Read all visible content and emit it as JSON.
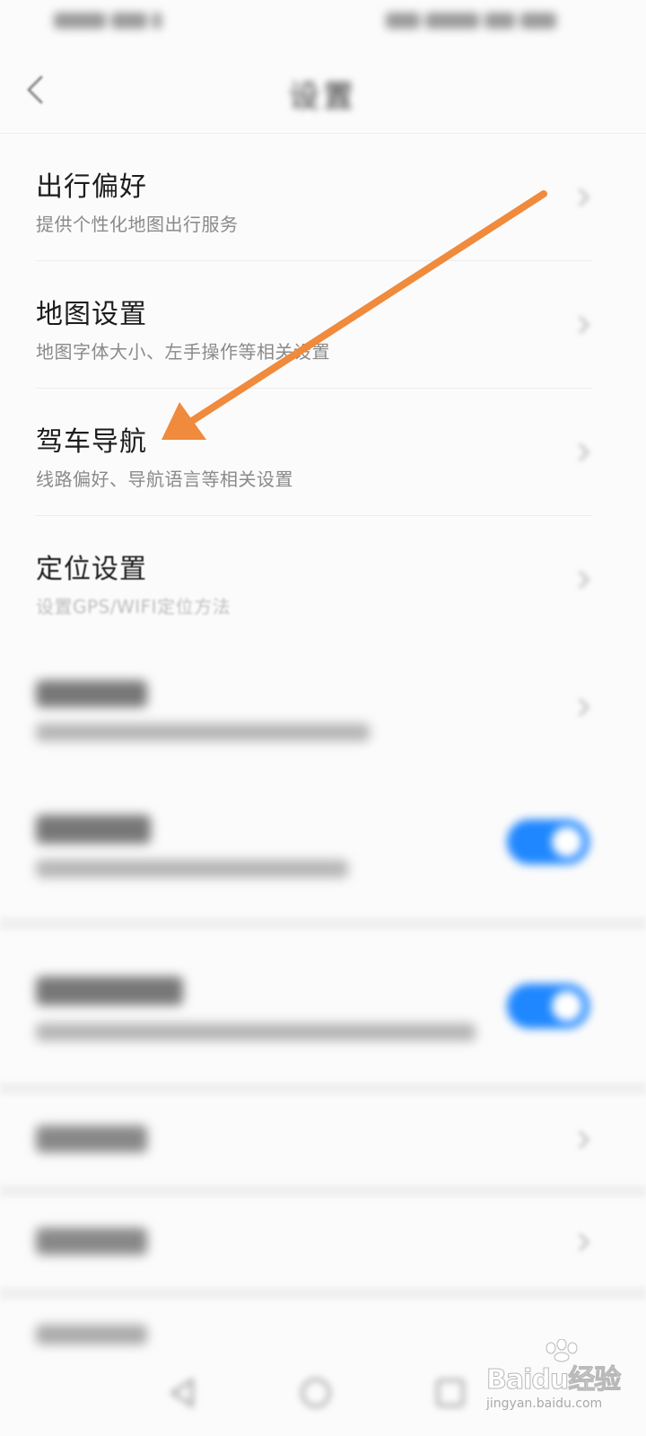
{
  "status_bar": {},
  "header": {
    "title": "设置"
  },
  "settings": [
    {
      "title": "出行偏好",
      "subtitle": "提供个性化地图出行服务"
    },
    {
      "title": "地图设置",
      "subtitle": "地图字体大小、左手操作等相关设置"
    },
    {
      "title": "驾车导航",
      "subtitle": "线路偏好、导航语言等相关设置"
    },
    {
      "title": "定位设置",
      "subtitle": "设置GPS/WIFI定位方法"
    }
  ],
  "toggles": [
    {
      "state": "on"
    },
    {
      "state": "on"
    }
  ],
  "annotation": {
    "arrow_color": "#f08a3c",
    "points_to": "驾车导航"
  },
  "watermark": {
    "logo": "Baidu经验",
    "url": "jingyan.baidu.com"
  },
  "colors": {
    "toggle_on": "#1f87ff",
    "background": "#fbfbfb"
  }
}
